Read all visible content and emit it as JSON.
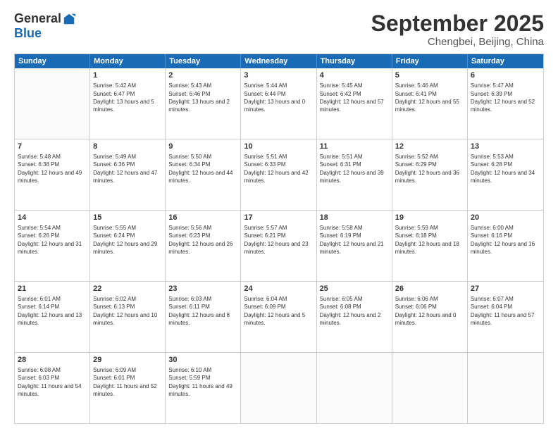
{
  "logo": {
    "general": "General",
    "blue": "Blue"
  },
  "title": "September 2025",
  "subtitle": "Chengbei, Beijing, China",
  "header_days": [
    "Sunday",
    "Monday",
    "Tuesday",
    "Wednesday",
    "Thursday",
    "Friday",
    "Saturday"
  ],
  "weeks": [
    [
      {
        "day": "",
        "sunrise": "",
        "sunset": "",
        "daylight": ""
      },
      {
        "day": "1",
        "sunrise": "Sunrise: 5:42 AM",
        "sunset": "Sunset: 6:47 PM",
        "daylight": "Daylight: 13 hours and 5 minutes."
      },
      {
        "day": "2",
        "sunrise": "Sunrise: 5:43 AM",
        "sunset": "Sunset: 6:46 PM",
        "daylight": "Daylight: 13 hours and 2 minutes."
      },
      {
        "day": "3",
        "sunrise": "Sunrise: 5:44 AM",
        "sunset": "Sunset: 6:44 PM",
        "daylight": "Daylight: 13 hours and 0 minutes."
      },
      {
        "day": "4",
        "sunrise": "Sunrise: 5:45 AM",
        "sunset": "Sunset: 6:42 PM",
        "daylight": "Daylight: 12 hours and 57 minutes."
      },
      {
        "day": "5",
        "sunrise": "Sunrise: 5:46 AM",
        "sunset": "Sunset: 6:41 PM",
        "daylight": "Daylight: 12 hours and 55 minutes."
      },
      {
        "day": "6",
        "sunrise": "Sunrise: 5:47 AM",
        "sunset": "Sunset: 6:39 PM",
        "daylight": "Daylight: 12 hours and 52 minutes."
      }
    ],
    [
      {
        "day": "7",
        "sunrise": "Sunrise: 5:48 AM",
        "sunset": "Sunset: 6:38 PM",
        "daylight": "Daylight: 12 hours and 49 minutes."
      },
      {
        "day": "8",
        "sunrise": "Sunrise: 5:49 AM",
        "sunset": "Sunset: 6:36 PM",
        "daylight": "Daylight: 12 hours and 47 minutes."
      },
      {
        "day": "9",
        "sunrise": "Sunrise: 5:50 AM",
        "sunset": "Sunset: 6:34 PM",
        "daylight": "Daylight: 12 hours and 44 minutes."
      },
      {
        "day": "10",
        "sunrise": "Sunrise: 5:51 AM",
        "sunset": "Sunset: 6:33 PM",
        "daylight": "Daylight: 12 hours and 42 minutes."
      },
      {
        "day": "11",
        "sunrise": "Sunrise: 5:51 AM",
        "sunset": "Sunset: 6:31 PM",
        "daylight": "Daylight: 12 hours and 39 minutes."
      },
      {
        "day": "12",
        "sunrise": "Sunrise: 5:52 AM",
        "sunset": "Sunset: 6:29 PM",
        "daylight": "Daylight: 12 hours and 36 minutes."
      },
      {
        "day": "13",
        "sunrise": "Sunrise: 5:53 AM",
        "sunset": "Sunset: 6:28 PM",
        "daylight": "Daylight: 12 hours and 34 minutes."
      }
    ],
    [
      {
        "day": "14",
        "sunrise": "Sunrise: 5:54 AM",
        "sunset": "Sunset: 6:26 PM",
        "daylight": "Daylight: 12 hours and 31 minutes."
      },
      {
        "day": "15",
        "sunrise": "Sunrise: 5:55 AM",
        "sunset": "Sunset: 6:24 PM",
        "daylight": "Daylight: 12 hours and 29 minutes."
      },
      {
        "day": "16",
        "sunrise": "Sunrise: 5:56 AM",
        "sunset": "Sunset: 6:23 PM",
        "daylight": "Daylight: 12 hours and 26 minutes."
      },
      {
        "day": "17",
        "sunrise": "Sunrise: 5:57 AM",
        "sunset": "Sunset: 6:21 PM",
        "daylight": "Daylight: 12 hours and 23 minutes."
      },
      {
        "day": "18",
        "sunrise": "Sunrise: 5:58 AM",
        "sunset": "Sunset: 6:19 PM",
        "daylight": "Daylight: 12 hours and 21 minutes."
      },
      {
        "day": "19",
        "sunrise": "Sunrise: 5:59 AM",
        "sunset": "Sunset: 6:18 PM",
        "daylight": "Daylight: 12 hours and 18 minutes."
      },
      {
        "day": "20",
        "sunrise": "Sunrise: 6:00 AM",
        "sunset": "Sunset: 6:16 PM",
        "daylight": "Daylight: 12 hours and 16 minutes."
      }
    ],
    [
      {
        "day": "21",
        "sunrise": "Sunrise: 6:01 AM",
        "sunset": "Sunset: 6:14 PM",
        "daylight": "Daylight: 12 hours and 13 minutes."
      },
      {
        "day": "22",
        "sunrise": "Sunrise: 6:02 AM",
        "sunset": "Sunset: 6:13 PM",
        "daylight": "Daylight: 12 hours and 10 minutes."
      },
      {
        "day": "23",
        "sunrise": "Sunrise: 6:03 AM",
        "sunset": "Sunset: 6:11 PM",
        "daylight": "Daylight: 12 hours and 8 minutes."
      },
      {
        "day": "24",
        "sunrise": "Sunrise: 6:04 AM",
        "sunset": "Sunset: 6:09 PM",
        "daylight": "Daylight: 12 hours and 5 minutes."
      },
      {
        "day": "25",
        "sunrise": "Sunrise: 6:05 AM",
        "sunset": "Sunset: 6:08 PM",
        "daylight": "Daylight: 12 hours and 2 minutes."
      },
      {
        "day": "26",
        "sunrise": "Sunrise: 6:06 AM",
        "sunset": "Sunset: 6:06 PM",
        "daylight": "Daylight: 12 hours and 0 minutes."
      },
      {
        "day": "27",
        "sunrise": "Sunrise: 6:07 AM",
        "sunset": "Sunset: 6:04 PM",
        "daylight": "Daylight: 11 hours and 57 minutes."
      }
    ],
    [
      {
        "day": "28",
        "sunrise": "Sunrise: 6:08 AM",
        "sunset": "Sunset: 6:03 PM",
        "daylight": "Daylight: 11 hours and 54 minutes."
      },
      {
        "day": "29",
        "sunrise": "Sunrise: 6:09 AM",
        "sunset": "Sunset: 6:01 PM",
        "daylight": "Daylight: 11 hours and 52 minutes."
      },
      {
        "day": "30",
        "sunrise": "Sunrise: 6:10 AM",
        "sunset": "Sunset: 5:59 PM",
        "daylight": "Daylight: 11 hours and 49 minutes."
      },
      {
        "day": "",
        "sunrise": "",
        "sunset": "",
        "daylight": ""
      },
      {
        "day": "",
        "sunrise": "",
        "sunset": "",
        "daylight": ""
      },
      {
        "day": "",
        "sunrise": "",
        "sunset": "",
        "daylight": ""
      },
      {
        "day": "",
        "sunrise": "",
        "sunset": "",
        "daylight": ""
      }
    ]
  ]
}
